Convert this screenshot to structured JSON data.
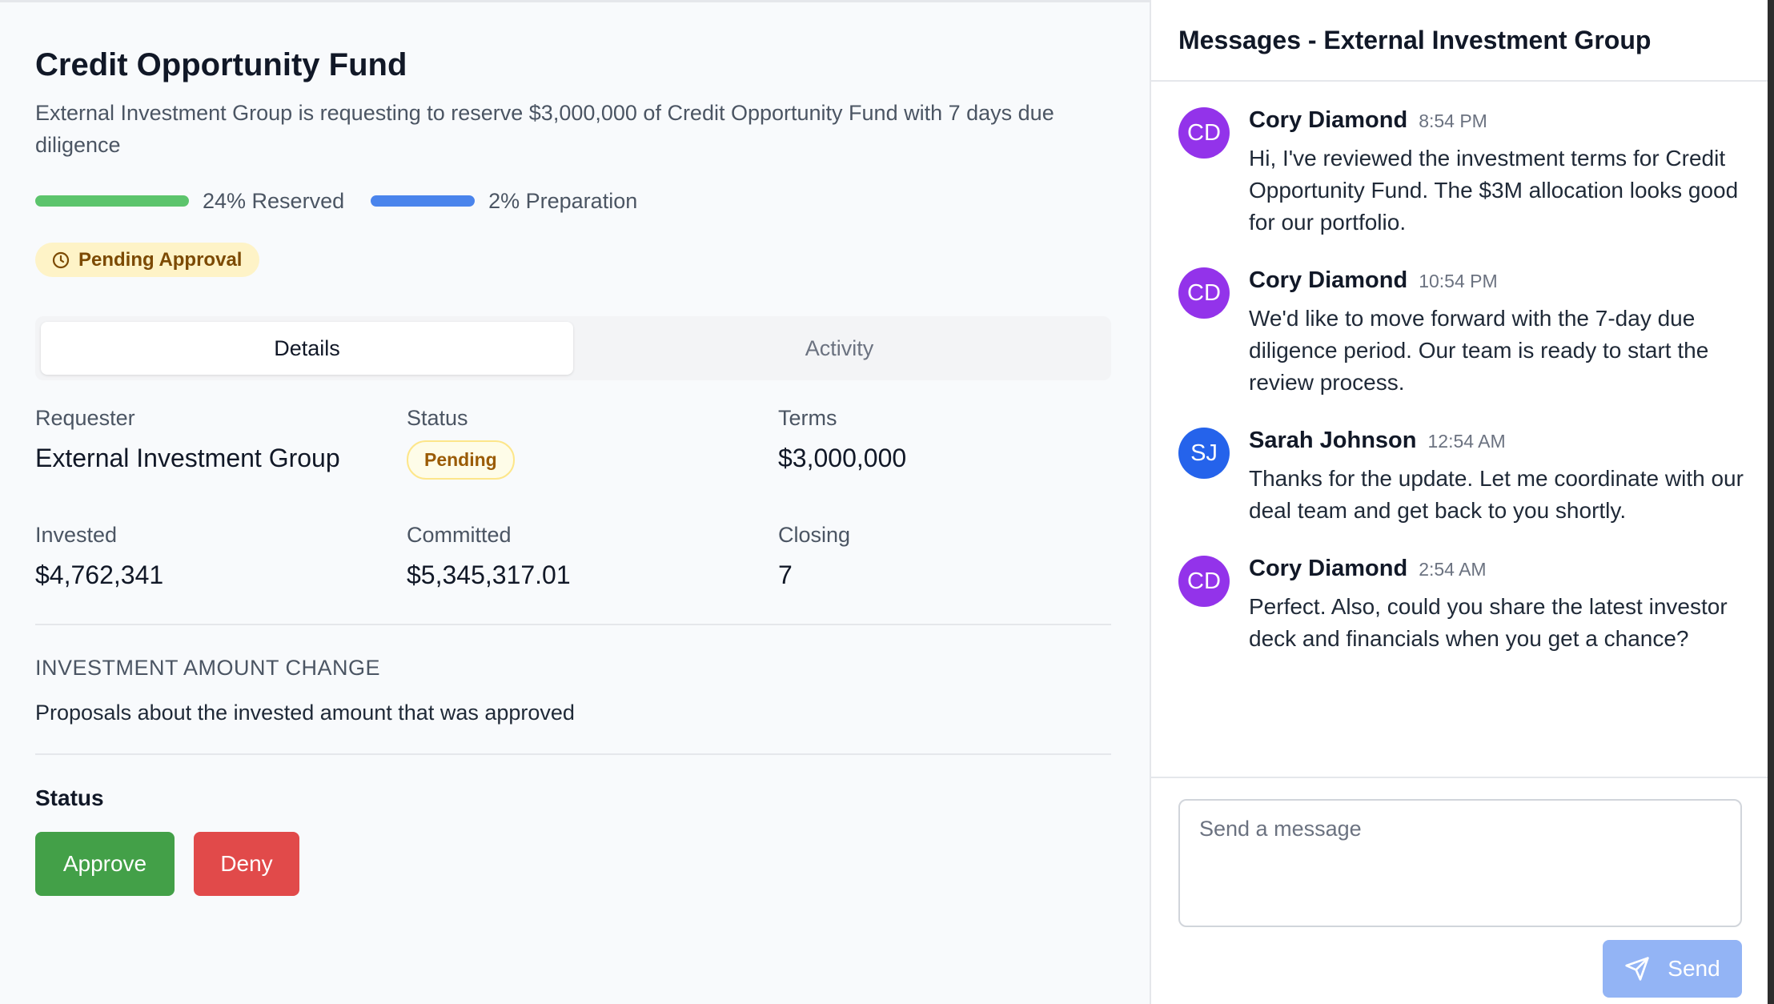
{
  "deal": {
    "title": "Credit Opportunity Fund",
    "subtitle": "External Investment Group is requesting to reserve $3,000,000 of Credit Opportunity Fund with 7 days due diligence"
  },
  "progress": {
    "reserved": {
      "label": "24% Reserved",
      "percent": 24,
      "color": "#5cc46c"
    },
    "preparation": {
      "label": "2% Preparation",
      "percent": 2,
      "color": "#4a84ec"
    }
  },
  "approval_badge": {
    "label": "Pending Approval",
    "icon": "clock-icon"
  },
  "tabs": [
    {
      "label": "Details",
      "active": true
    },
    {
      "label": "Activity",
      "active": false
    }
  ],
  "details": {
    "requester": {
      "label": "Requester",
      "value": "External Investment Group"
    },
    "status": {
      "label": "Status",
      "value": "Pending"
    },
    "terms": {
      "label": "Terms",
      "value": "$3,000,000"
    },
    "invested": {
      "label": "Invested",
      "value": "$4,762,341"
    },
    "committed": {
      "label": "Committed",
      "value": "$5,345,317.01"
    },
    "closing": {
      "label": "Closing",
      "value": "7"
    }
  },
  "section": {
    "heading": "INVESTMENT AMOUNT CHANGE",
    "text": "Proposals about the invested amount that was approved"
  },
  "actions": {
    "status_label": "Status",
    "approve_label": "Approve",
    "deny_label": "Deny"
  },
  "messages": {
    "header": "Messages - External Investment Group",
    "items": [
      {
        "initials": "CD",
        "name": "Cory Diamond",
        "time": "8:54 PM",
        "avatar_color": "#9333ea",
        "text": "Hi, I've reviewed the investment terms for Credit Opportunity Fund. The $3M allocation looks good for our portfolio."
      },
      {
        "initials": "CD",
        "name": "Cory Diamond",
        "time": "10:54 PM",
        "avatar_color": "#9333ea",
        "text": "We'd like to move forward with the 7-day due diligence period. Our team is ready to start the review process."
      },
      {
        "initials": "SJ",
        "name": "Sarah Johnson",
        "time": "12:54 AM",
        "avatar_color": "#2563eb",
        "text": "Thanks for the update. Let me coordinate with our deal team and get back to you shortly."
      },
      {
        "initials": "CD",
        "name": "Cory Diamond",
        "time": "2:54 AM",
        "avatar_color": "#9333ea",
        "text": "Perfect. Also, could you share the latest investor deck and financials when you get a chance?"
      }
    ],
    "input_placeholder": "Send a message",
    "send_label": "Send",
    "send_icon": "paper-plane-icon"
  }
}
